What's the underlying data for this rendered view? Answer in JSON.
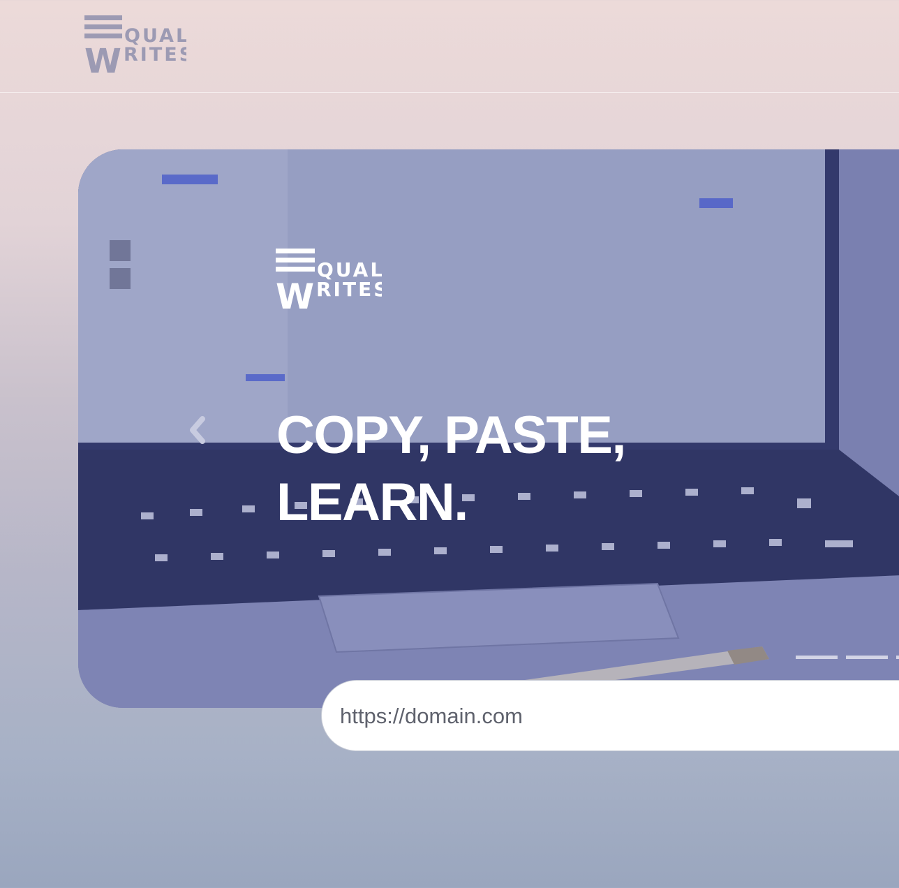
{
  "header": {
    "logo_top": "QUAL",
    "logo_w": "W",
    "logo_bottom": "RITES"
  },
  "hero": {
    "logo_top": "QUAL",
    "logo_w": "W",
    "logo_bottom": "RITES",
    "title_line1": "COPY, PASTE,",
    "title_line2": "LEARN.",
    "prev_icon": "chevron-left-icon",
    "photo": "laptop-keyboard-photo",
    "indicators": 3
  },
  "url_input": {
    "placeholder": "https://domain.com"
  },
  "colors": {
    "header_logo": "#9c9ab3",
    "hero_text": "#ffffff",
    "overlay": "#464e96"
  }
}
